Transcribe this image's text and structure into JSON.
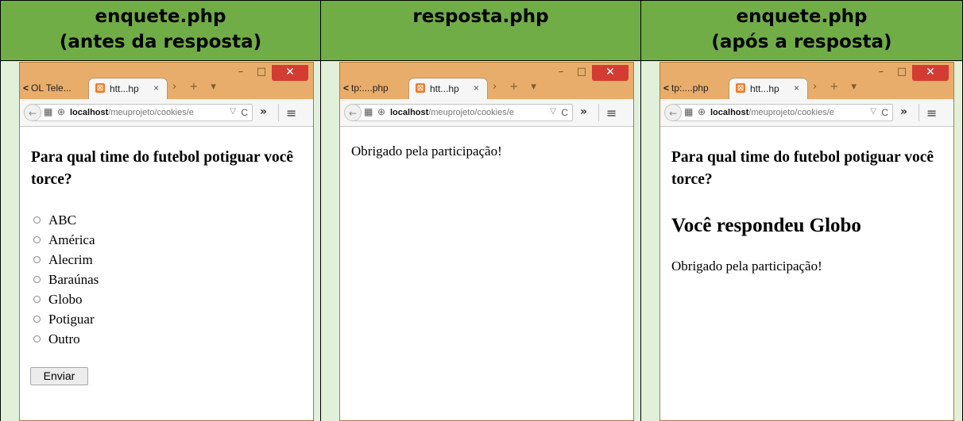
{
  "columns": [
    {
      "header_line1": "enquete.php",
      "header_line2": "(antes da resposta)"
    },
    {
      "header_line1": "resposta.php",
      "header_line2": ""
    },
    {
      "header_line1": "enquete.php",
      "header_line2": "(após a resposta)"
    }
  ],
  "browsers": [
    {
      "prev_tab": "OL Tele...",
      "tab_title": "htt...hp",
      "url_host": "localhost",
      "url_path": "/meuprojeto/cookies/e",
      "question": "Para qual time do futebol potiguar você torce?",
      "options": [
        "ABC",
        "América",
        "Alecrim",
        "Baraúnas",
        "Globo",
        "Potiguar",
        "Outro"
      ],
      "submit_label": "Enviar"
    },
    {
      "prev_tab": "tp:....php",
      "tab_title": "htt...hp",
      "url_host": "localhost",
      "url_path": "/meuprojeto/cookies/e",
      "message": "Obrigado pela participação!"
    },
    {
      "prev_tab": "tp:....php",
      "tab_title": "htt...hp",
      "url_host": "localhost",
      "url_path": "/meuprojeto/cookies/e",
      "question": "Para qual time do futebol potiguar você torce?",
      "response": "Você respondeu Globo",
      "message": "Obrigado pela participação!"
    }
  ],
  "colors": {
    "header_bg": "#70ad47",
    "cell_bg": "#e2efd9",
    "window_frame": "#e8ad6b",
    "close_button": "#d33c32",
    "favicon": "#f07a28"
  },
  "icons": {
    "back": "arrow-left-icon",
    "reload": "reload-icon",
    "menu": "hamburger-menu-icon",
    "close": "close-icon"
  }
}
